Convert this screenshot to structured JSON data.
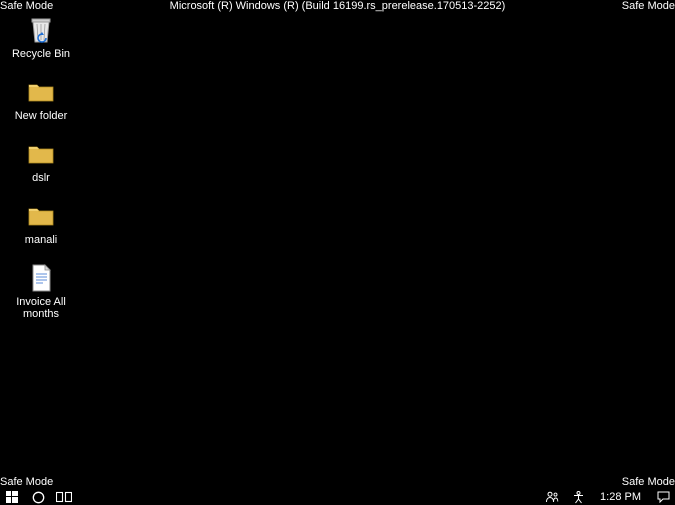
{
  "corners": {
    "top_left": "Safe Mode",
    "top_right": "Safe Mode",
    "bottom_left": "Safe Mode",
    "bottom_right": "Safe Mode"
  },
  "build_string": "Microsoft (R) Windows (R) (Build 16199.rs_prerelease.170513-2252)",
  "desktop": {
    "icons": [
      {
        "name": "recycle-bin",
        "label": "Recycle Bin",
        "type": "bin"
      },
      {
        "name": "new-folder",
        "label": "New folder",
        "type": "folder"
      },
      {
        "name": "dslr",
        "label": "dslr",
        "type": "folder"
      },
      {
        "name": "manali",
        "label": "manali",
        "type": "folder"
      },
      {
        "name": "invoice-all-months",
        "label": "Invoice All months",
        "type": "document"
      }
    ]
  },
  "taskbar": {
    "clock": "1:28 PM"
  }
}
